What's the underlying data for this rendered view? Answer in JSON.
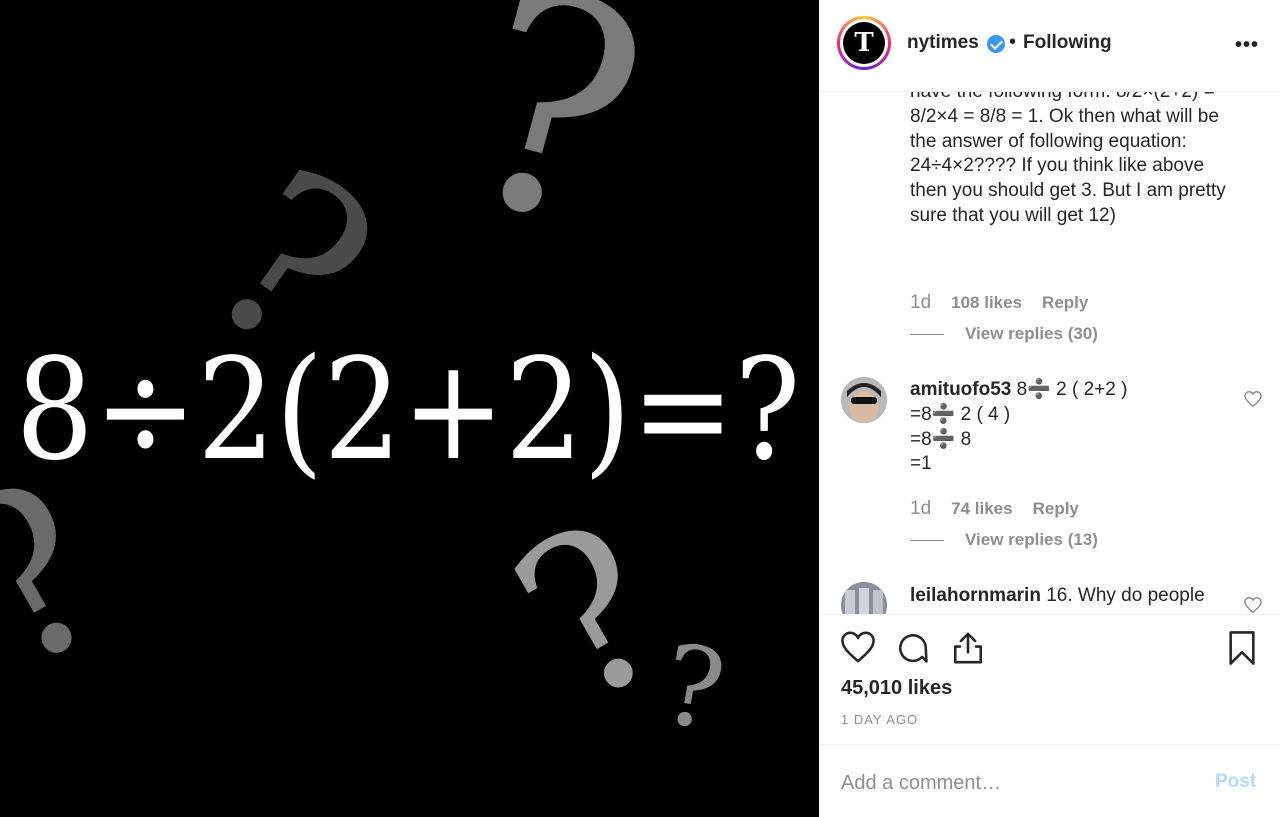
{
  "image": {
    "equation": "8÷2(2+2)=?"
  },
  "header": {
    "username": "nytimes",
    "separator": "•",
    "follow_status": "Following",
    "more_label": "•••",
    "avatar_letter": "T",
    "verified_icon": "verified-badge-icon"
  },
  "comments": [
    {
      "text": "have the following form: 8/2×(2+2) = 8/2×4 = 8/8 = 1. Ok then what will be the answer of following equation: 24÷4×2???? If you think like above then you should get 3. But I am pretty sure that you will get 12)",
      "time": "1d",
      "likes": "108 likes",
      "reply": "Reply",
      "view_replies": "View replies (30)"
    },
    {
      "username": "amituofo53",
      "text_lines": [
        "8➗ 2 ( 2+2 )",
        "=8➗ 2 ( 4 )",
        "=8➗ 8",
        "=1"
      ],
      "time": "1d",
      "likes": "74 likes",
      "reply": "Reply",
      "view_replies": "View replies (13)"
    },
    {
      "username": "leilahornmarin",
      "text": "16. Why do people"
    }
  ],
  "actions": {
    "likes": "45,010 likes",
    "time": "1 DAY AGO"
  },
  "comment_box": {
    "placeholder": "Add a comment…",
    "post_label": "Post"
  },
  "colors": {
    "accent": "#3897f0",
    "post_disabled": "#b3dbff",
    "muted": "#8e8e8e",
    "text": "#262626"
  }
}
